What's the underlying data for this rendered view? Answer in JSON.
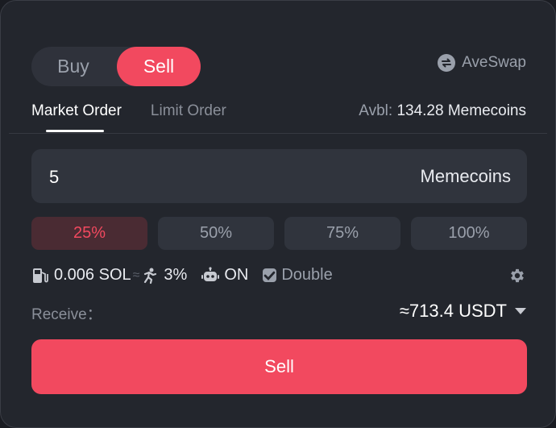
{
  "side_toggle": {
    "buy_label": "Buy",
    "sell_label": "Sell",
    "selected": "Sell"
  },
  "brand": {
    "name": "AveSwap",
    "icon": "swap-icon"
  },
  "order_tabs": [
    {
      "label": "Market Order",
      "active": true
    },
    {
      "label": "Limit Order",
      "active": false
    }
  ],
  "available": {
    "label": "Avbl:",
    "value": "134.28 Memecoins"
  },
  "amount": {
    "value": "5",
    "unit": "Memecoins"
  },
  "percent_buttons": [
    {
      "label": "25%",
      "active": true
    },
    {
      "label": "50%",
      "active": false
    },
    {
      "label": "75%",
      "active": false
    },
    {
      "label": "100%",
      "active": false
    }
  ],
  "options": {
    "gas": {
      "value": "0.006 SOL",
      "icon": "gas-pump-icon"
    },
    "slippage": {
      "value": "3%",
      "icon": "slippage-runner-icon"
    },
    "bot": {
      "value": "ON",
      "icon": "robot-icon"
    },
    "double": {
      "label": "Double",
      "checked": true
    }
  },
  "receive": {
    "label": "Receive：",
    "value": "≈713.4 USDT"
  },
  "submit": {
    "label": "Sell"
  },
  "colors": {
    "accent": "#f2495f",
    "panel": "#23262d",
    "field": "#30343d"
  }
}
